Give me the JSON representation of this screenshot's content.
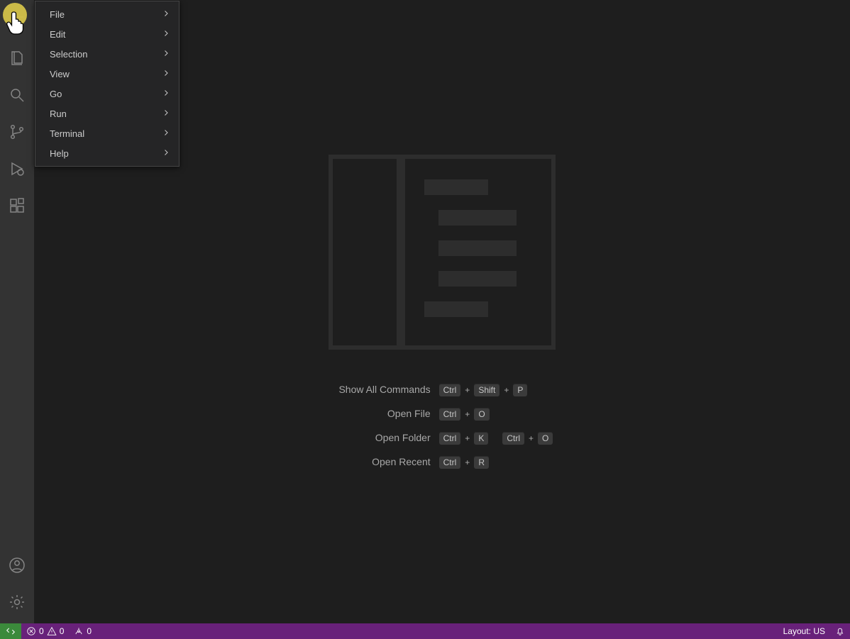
{
  "menu": {
    "items": [
      {
        "label": "File"
      },
      {
        "label": "Edit"
      },
      {
        "label": "Selection"
      },
      {
        "label": "View"
      },
      {
        "label": "Go"
      },
      {
        "label": "Run"
      },
      {
        "label": "Terminal"
      },
      {
        "label": "Help"
      }
    ]
  },
  "watermark": {
    "showAllCommands": {
      "label": "Show All Commands",
      "keys": [
        "Ctrl",
        "Shift",
        "P"
      ]
    },
    "openFile": {
      "label": "Open File",
      "keys": [
        "Ctrl",
        "O"
      ]
    },
    "openFolder": {
      "label": "Open Folder",
      "keys": [
        "Ctrl",
        "K"
      ],
      "keys2": [
        "Ctrl",
        "O"
      ]
    },
    "openRecent": {
      "label": "Open Recent",
      "keys": [
        "Ctrl",
        "R"
      ]
    }
  },
  "statusbar": {
    "errors": "0",
    "warnings": "0",
    "ports": "0",
    "layout": "Layout: US"
  }
}
